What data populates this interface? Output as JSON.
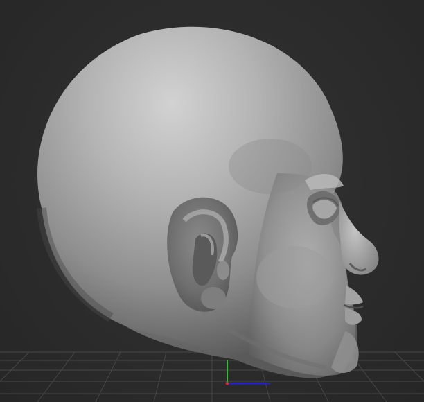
{
  "viewport": {
    "background_color": "#2b2b2b",
    "grid_visible": true,
    "grid_color": "#474747",
    "model": "sculpted-head",
    "model_material_color": "#a9a9a9"
  },
  "gizmo": {
    "x_axis_color": "#2424b8",
    "y_axis_color": "#2fbf2f",
    "z_axis_color": "#c83232"
  }
}
